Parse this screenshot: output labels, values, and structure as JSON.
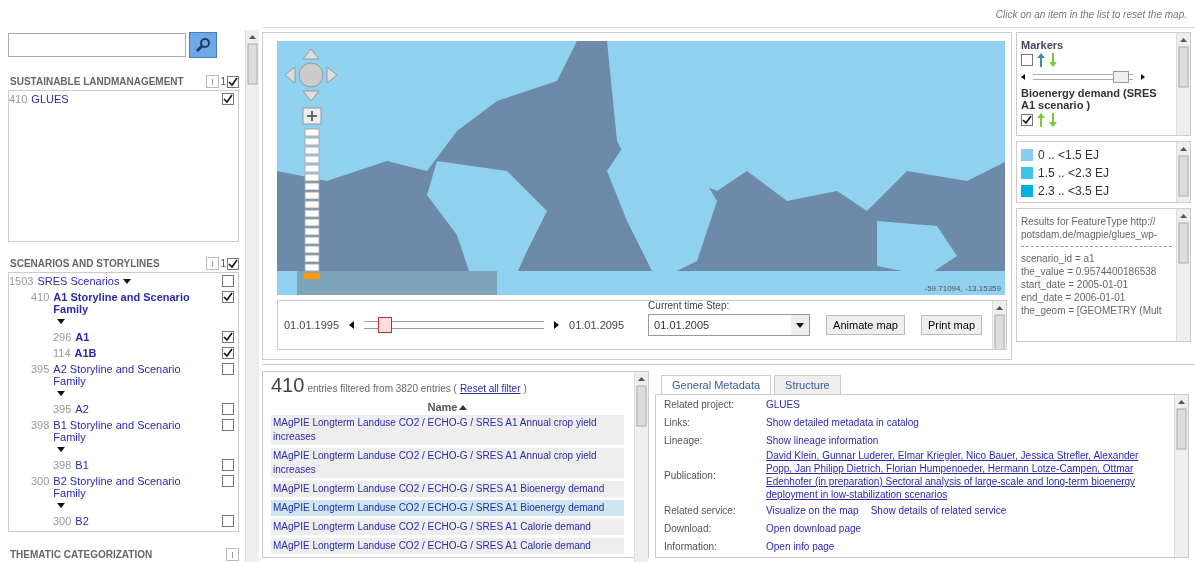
{
  "hint": "Click on an item in the list to reset the map.",
  "sidebar": {
    "sections": [
      {
        "title": "SUSTAINABLE LANDMANAGEMENT",
        "count": "1",
        "checked": true,
        "items": [
          {
            "count": "410",
            "label": "GLUES",
            "selected": false,
            "checked": true
          }
        ]
      },
      {
        "title": "SCENARIOS AND STORYLINES",
        "count": "1",
        "checked": true,
        "items": [
          {
            "count": "1503",
            "label": "SRES Scenarios",
            "selected": false,
            "checked": false,
            "children": [
              {
                "count": "410",
                "label": "A1 Storyline and Scenario Family",
                "selected": true,
                "checked": true,
                "children": [
                  {
                    "count": "296",
                    "label": "A1",
                    "selected": true,
                    "checked": true
                  },
                  {
                    "count": "114",
                    "label": "A1B",
                    "selected": true,
                    "checked": true
                  }
                ]
              },
              {
                "count": "395",
                "label": "A2 Storyline and Scenario Family",
                "selected": false,
                "checked": false,
                "children": [
                  {
                    "count": "395",
                    "label": "A2",
                    "selected": false,
                    "checked": false
                  }
                ]
              },
              {
                "count": "398",
                "label": "B1 Storyline and Scenario Family",
                "selected": false,
                "checked": false,
                "children": [
                  {
                    "count": "398",
                    "label": "B1",
                    "selected": false,
                    "checked": false
                  }
                ]
              },
              {
                "count": "300",
                "label": "B2 Storyline and Scenario Family",
                "selected": false,
                "checked": false,
                "children": [
                  {
                    "count": "300",
                    "label": "B2",
                    "selected": false,
                    "checked": false
                  }
                ]
              }
            ]
          }
        ]
      },
      {
        "title": "THEMATIC CATEGORIZATION"
      }
    ]
  },
  "map": {
    "coordinates": "-59.71094, -13.15359"
  },
  "timeline": {
    "start": "01.01.1995",
    "end": "01.01.2095",
    "level": 0.12,
    "step_label": "Current time Step:",
    "step_value": "01.01.2005",
    "buttons": [
      "Animate map",
      "Print map"
    ]
  },
  "layers": [
    {
      "name": "Markers",
      "checked": false,
      "level": 0.88
    },
    {
      "name": "Bioenergy demand (SRES A1 scenario )",
      "checked": true
    }
  ],
  "legend": [
    {
      "label": "0 .. <1.5 EJ",
      "color": "#87ceeb"
    },
    {
      "label": "1.5 .. <2.3 EJ",
      "color": "#3ec3e8"
    },
    {
      "label": "2.3 .. <3.5 EJ",
      "color": "#00b0de"
    }
  ],
  "results": [
    "Results for FeatureType http://",
    "potsdam.de/magpie/glues_wp-",
    "scenario_id = a1",
    "the_value = 0.9574400186538",
    "start_date = 2005-01-01",
    "end_date = 2006-01-01",
    "the_geom = [GEOMETRY (Mult"
  ],
  "list": {
    "count": "410",
    "summary": "entries filtered from 3820 entries (",
    "reset": "Reset all filter",
    "close": ")",
    "column": "Name",
    "rows": [
      {
        "name": "MAgPIE Longterm Landuse CO2 / ECHO-G / SRES A1 Annual crop yield increases",
        "selected": false
      },
      {
        "name": "MAgPIE Longterm Landuse CO2 / ECHO-G / SRES A1 Annual crop yield increases",
        "selected": false
      },
      {
        "name": "MAgPIE Longterm Landuse CO2 / ECHO-G / SRES A1 Bioenergy demand",
        "selected": false
      },
      {
        "name": "MAgPIE Longterm Landuse CO2 / ECHO-G / SRES A1 Bioenergy demand",
        "selected": true
      },
      {
        "name": "MAgPIE Longterm Landuse CO2 / ECHO-G / SRES A1 Calorie demand",
        "selected": false
      },
      {
        "name": "MAgPIE Longterm Landuse CO2 / ECHO-G / SRES A1 Calorie demand",
        "selected": false
      }
    ]
  },
  "details": {
    "tabs": [
      {
        "label": "General Metadata",
        "selected": true
      },
      {
        "label": "Structure",
        "selected": false
      }
    ],
    "rows": [
      {
        "label": "Related project:",
        "links": [
          "GLUES"
        ]
      },
      {
        "label": "Links:",
        "links": [
          "Show detailed metadata in catalog"
        ]
      },
      {
        "label": "Lineage:",
        "links": [
          "Show lineage information"
        ]
      },
      {
        "label": "Publication:",
        "kind": "publication",
        "links": [
          "David Klein, Gunnar Luderer, Elmar Kriegler, Nico Bauer, Jessica Strefler, Alexander Popp, Jan Philipp Dietrich, Florian Humpenoeder, Hermann Lotze-Campen, Ottmar Edenhofer (in preparation) Sectoral analysis of large-scale and long-term bioenergy deployment in low-stabilization scenarios"
        ]
      },
      {
        "label": "Related service:",
        "links": [
          "Visualize on the map",
          "Show details of related service"
        ]
      },
      {
        "label": "Download:",
        "links": [
          "Open download page"
        ]
      },
      {
        "label": "Information:",
        "links": [
          "Open info page"
        ]
      }
    ]
  }
}
